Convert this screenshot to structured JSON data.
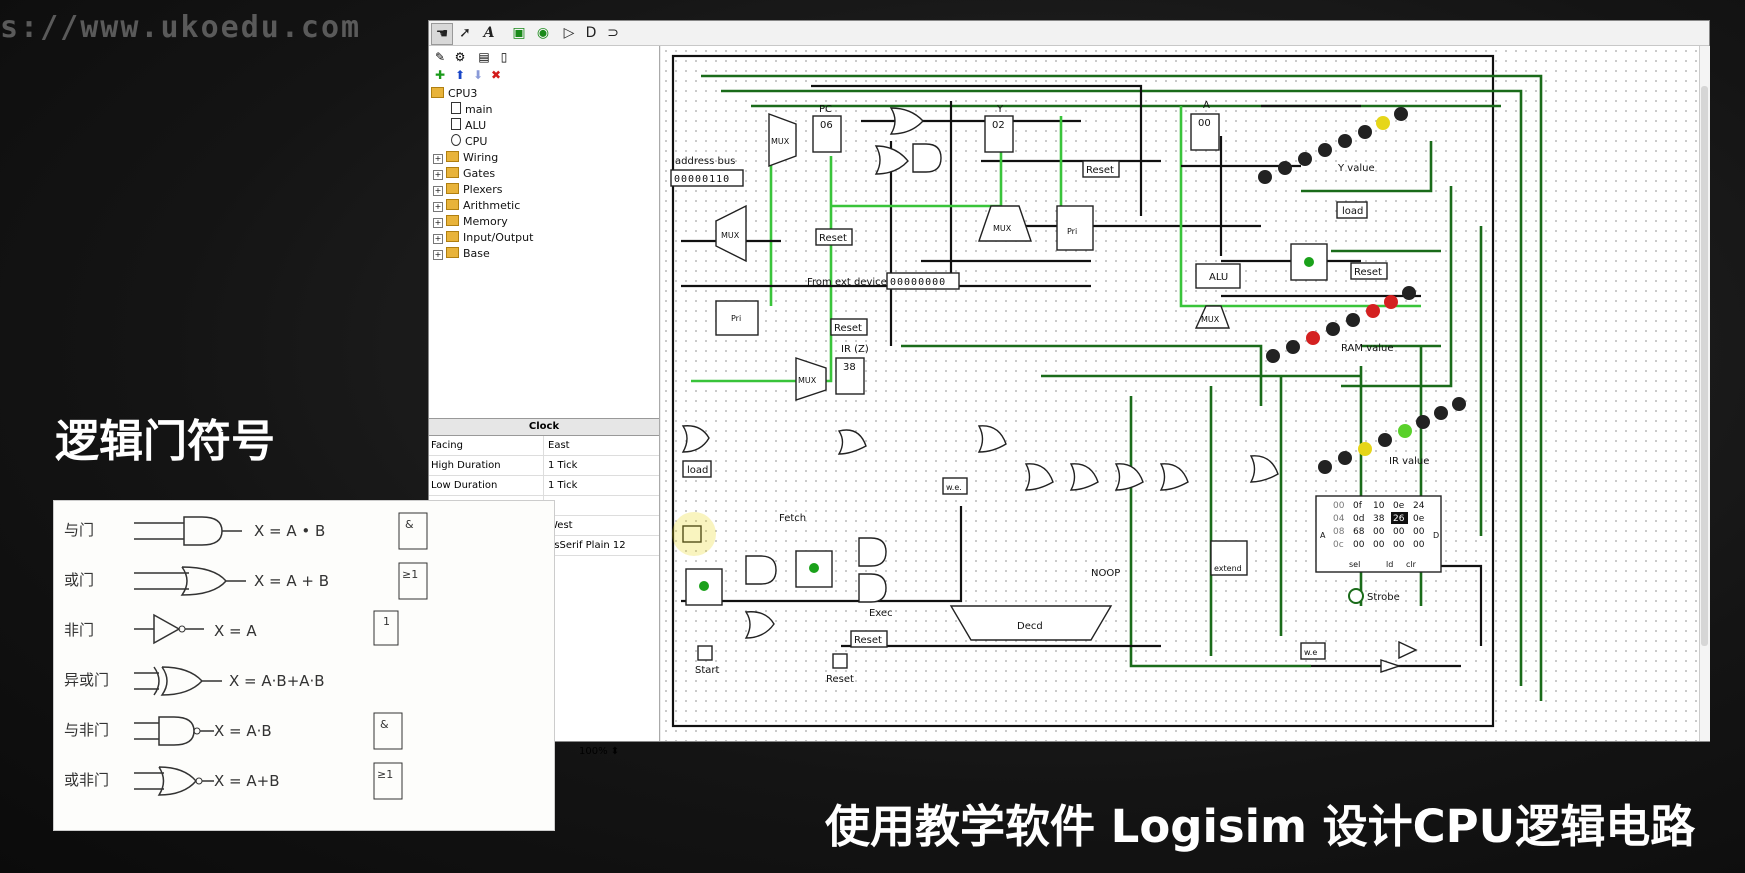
{
  "watermark": "s://www.ukoedu.com",
  "toolbar": {
    "tools": [
      "hand-tool",
      "select-tool",
      "text-tool",
      "input-pin-tool",
      "output-pin-tool",
      "not-gate-tool",
      "and-gate-tool",
      "or-gate-tool"
    ]
  },
  "project": {
    "root": "CPU3",
    "circuits": [
      "main",
      "ALU",
      "CPU"
    ],
    "libraries": [
      "Wiring",
      "Gates",
      "Plexers",
      "Arithmetic",
      "Memory",
      "Input/Output",
      "Base"
    ]
  },
  "attributes": {
    "title": "Clock",
    "rows": [
      {
        "key": "Facing",
        "value": "East"
      },
      {
        "key": "High Duration",
        "value": "1 Tick"
      },
      {
        "key": "Low Duration",
        "value": "1 Tick"
      },
      {
        "key": "Label",
        "value": ""
      },
      {
        "key": "",
        "value": "West"
      },
      {
        "key": "",
        "value": "nsSerif Plain 12"
      }
    ]
  },
  "zoom": "100%",
  "circuit": {
    "address_bus_label": "address bus",
    "address_bus_value": "00000110",
    "pc_label": "PC",
    "pc_value": "06",
    "y_label": "Y",
    "y_value": "02",
    "a_label": "A",
    "a_value": "00",
    "ir_label": "IR (Z)",
    "ir_value": "38",
    "ext_label": "From ext device",
    "ext_value": "00000000",
    "mux": "MUX",
    "pri": "Pri",
    "alu": "ALU",
    "reset": "Reset",
    "load": "load",
    "y_value_label": "Y value",
    "ram_value_label": "RAM value",
    "ir_value_label": "IR value",
    "fetch": "Fetch",
    "exec": "Exec",
    "noop": "NOOP",
    "decd": "Decd",
    "extend": "extend",
    "we": "w.e.",
    "we2": "w.e",
    "strobe": "Strobe",
    "start": "Start",
    "ram_rows": [
      [
        "00",
        "0f",
        "10",
        "0e",
        "24"
      ],
      [
        "04",
        "0d",
        "38",
        "26",
        "0e"
      ],
      [
        "08",
        "68",
        "00",
        "00",
        "00"
      ],
      [
        "0c",
        "00",
        "00",
        "00",
        "00"
      ]
    ],
    "ram_selected": "26",
    "ram_bottom": [
      "sel",
      "ld",
      "clr"
    ],
    "ram_ports": [
      "A",
      "D"
    ]
  },
  "overlay": {
    "title": "逻辑门符号",
    "caption": "使用教学软件 Logisim 设计CPU逻辑电路"
  },
  "gates": [
    {
      "name": "与门",
      "eq": "X = A • B"
    },
    {
      "name": "或门",
      "eq": "X = A + B"
    },
    {
      "name": "非门",
      "eq": "X = A"
    },
    {
      "name": "异或门",
      "eq": "X = A·B+A·B"
    },
    {
      "name": "与非门",
      "eq": "X = A·B"
    },
    {
      "name": "或非门",
      "eq": "X = A+B"
    }
  ],
  "gate_symbols": [
    "&",
    "≥1",
    "1"
  ]
}
